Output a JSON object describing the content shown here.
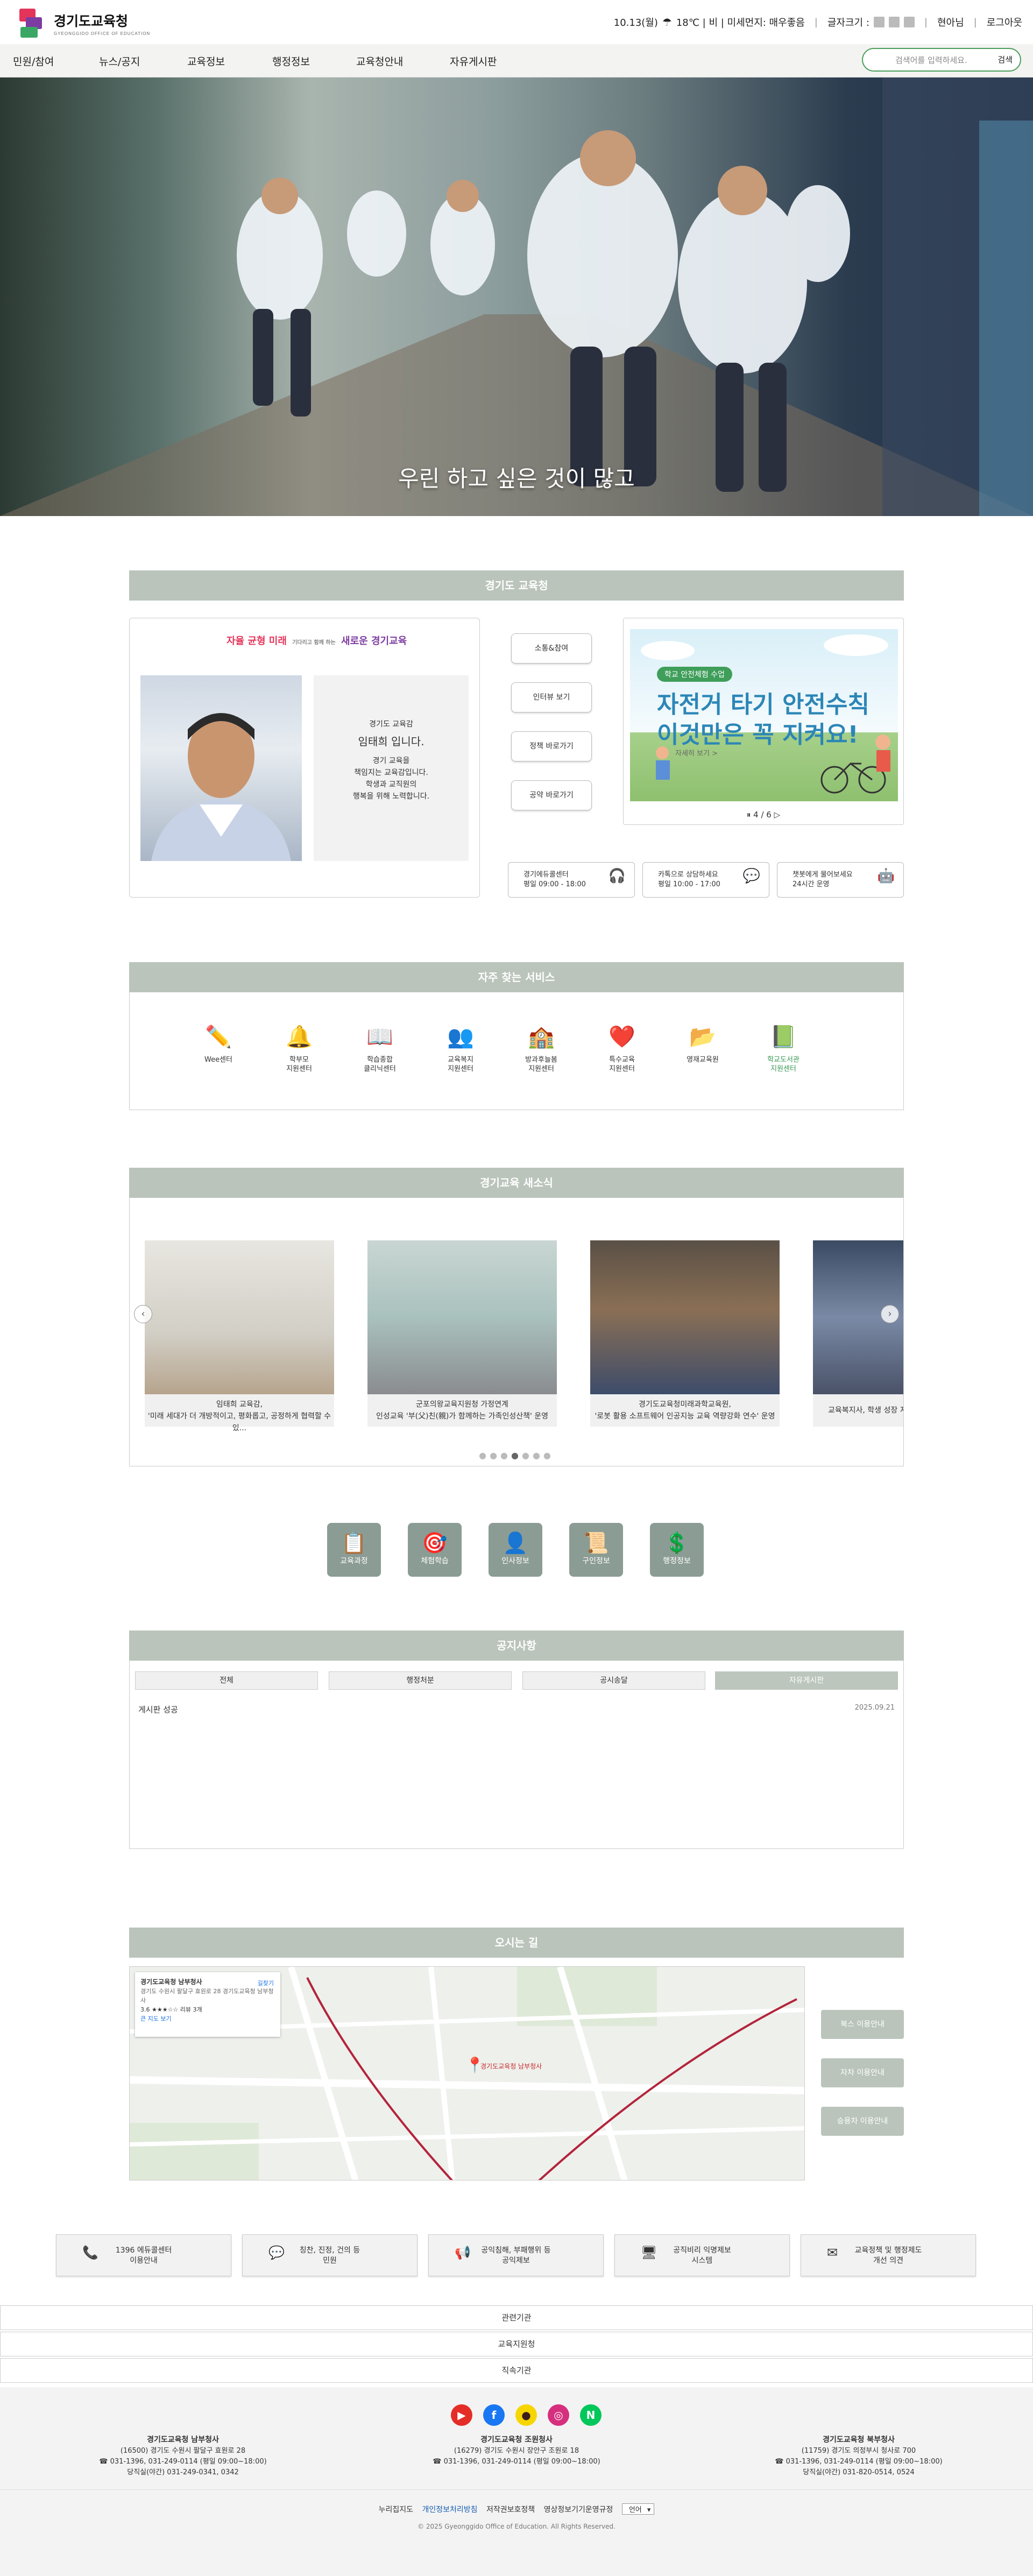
{
  "header": {
    "logo_title": "경기도교육청",
    "logo_sub": "GYEONGGIDO OFFICE OF EDUCATION",
    "weather": "10.13(월)",
    "weather_detail": "18℃ | 비 | 미세먼지: 매우좋음",
    "font_size_label": "글자크기 :",
    "user": "현아님",
    "logout": "로그아웃"
  },
  "nav": {
    "items": [
      "민원/참여",
      "뉴스/공지",
      "교육정보",
      "행정정보",
      "교육청안내",
      "자유게시판"
    ],
    "search_placeholder": "검색어를 입력하세요.",
    "search_button": "검색"
  },
  "hero": {
    "caption": "우린 하고 싶은 것이 많고"
  },
  "intro": {
    "section_title": "경기도 교육청",
    "slogan_a": "자율 균형 미래",
    "slogan_b": "새로운 경기교육",
    "slogan_small": "기다리고 함께 하는",
    "greet_role": "경기도 교육감",
    "greet_name": "임태희 입니다.",
    "greet_l1": "경기 교육을",
    "greet_l2": "책임지는 교육감입니다.",
    "greet_l3": "학생과 교직원의",
    "greet_l4": "행복을 위해 노력합니다.",
    "buttons": [
      "소통&참여",
      "인터뷰 보기",
      "정책 바로가기",
      "공약 바로가기"
    ],
    "banner_tag": "학교 안전체험 수업",
    "banner_t1": "자전거 타기 안전수칙",
    "banner_t2": "이것만은 꼭 지켜요!",
    "banner_more": "자세히 보기 >",
    "banner_pager": "4 / 6",
    "contacts": [
      {
        "l1": "경기에듀콜센터",
        "l2": "평일 09:00 - 18:00"
      },
      {
        "l1": "카톡으로 상담하세요",
        "l2": "평일 10:00 - 17:00"
      },
      {
        "l1": "챗봇에게 물어보세요",
        "l2": "24시간 운영"
      }
    ]
  },
  "services": {
    "section_title": "자주 찾는 서비스",
    "items": [
      {
        "label": "Wee센터",
        "icon": "pencil-icon"
      },
      {
        "label": "학부모\n지원센터",
        "icon": "bell-icon"
      },
      {
        "label": "학습종합\n클리닉센터",
        "icon": "book-icon"
      },
      {
        "label": "교육복지\n지원센터",
        "icon": "people-icon"
      },
      {
        "label": "방과후늘봄\n지원센터",
        "icon": "school-icon"
      },
      {
        "label": "특수교육\n지원센터",
        "icon": "heart-icon"
      },
      {
        "label": "영재교육원",
        "icon": "folder-icon"
      },
      {
        "label": "학교도서관\n지원센터",
        "icon": "library-icon"
      }
    ]
  },
  "news": {
    "section_title": "경기교육 새소식",
    "cards": [
      {
        "l1": "임태희 교육감,",
        "l2": "'미래 세대가 더 개방적이고, 평화롭고, 공정하게 협력할 수 있..."
      },
      {
        "l1": "군포의왕교육지원청 가정연계",
        "l2": "인성교육 '부(父)친(親)가 함께하는 가족인성산책' 운영"
      },
      {
        "l1": "경기도교육청미래과학교육원,",
        "l2": "'로봇 활용 소프트웨어 인공지능 교육 역량강화 연수' 운영"
      },
      {
        "l1": "교육복지사, 학생 성장 지원",
        "l2": ""
      }
    ]
  },
  "quick_links": [
    "교육과정",
    "체험학습",
    "인사정보",
    "구인정보",
    "행정정보"
  ],
  "notice": {
    "section_title": "공지사항",
    "tabs": [
      "전체",
      "행정처분",
      "공시송달",
      "자유게시판"
    ],
    "rows": [
      {
        "title": "게시판 성공",
        "date": "2025.09.21"
      }
    ]
  },
  "directions": {
    "section_title": "오시는 길",
    "map_place": "경기도교육청 남부청사",
    "map_addr": "경기도 수원시 팔달구 효원로 28 경기도교육청 남부청사",
    "map_rating": "3.6 ★★★☆☆ 리뷰 3개",
    "map_directions": "길찾기",
    "map_large": "큰 지도 보기",
    "pin_label": "경기도교육청 남부청사",
    "side_buttons": [
      "북스 이용안내",
      "자차 이용안내",
      "승용차 이용안내"
    ]
  },
  "bottom_links": [
    {
      "l1": "1396 에듀콜센터",
      "l2": "이용안내"
    },
    {
      "l1": "칭찬, 진정, 건의 등",
      "l2": "민원"
    },
    {
      "l1": "공익침해, 부패행위 등",
      "l2": "공익제보"
    },
    {
      "l1": "공직비리 익명제보",
      "l2": "시스템"
    },
    {
      "l1": "교육정책 및 행정제도",
      "l2": "개선 의견"
    }
  ],
  "related": [
    "관련기관",
    "교육지원청",
    "직속기관"
  ],
  "footer": {
    "offices": [
      {
        "name": "경기도교육청 남부청사",
        "addr": "(16500) 경기도 수원시 팔달구 효원로 28",
        "tel": "☎ 031-1396, 031-249-0114 (평일 09:00~18:00)",
        "night": "당직실(야간) 031-249-0341, 0342"
      },
      {
        "name": "경기도교육청 조원청사",
        "addr": "(16279) 경기도 수원시 장안구 조원로 18",
        "tel": "☎ 031-1396, 031-249-0114 (평일 09:00~18:00)",
        "night": ""
      },
      {
        "name": "경기도교육청 북부청사",
        "addr": "(11759) 경기도 의정부시 청사로 700",
        "tel": "☎ 031-1396, 031-249-0114 (평일 09:00~18:00)",
        "night": "당직실(야간) 031-820-0514, 0524"
      }
    ],
    "links": [
      "누리집지도",
      "개인정보처리방침",
      "저작권보호정책",
      "영상정보기기운영규정"
    ],
    "lang": "언어",
    "copyright": "© 2025 Gyeonggido Office of Education. All Rights Reserved."
  },
  "colors": {
    "accent": "#4a9d5a",
    "section_bar": "#bac4bb",
    "quick_tile": "#8b9c94"
  }
}
